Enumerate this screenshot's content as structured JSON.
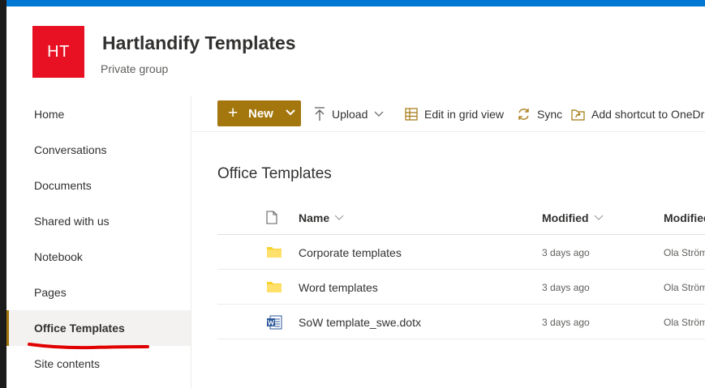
{
  "site": {
    "logo_initials": "HT",
    "title": "Hartlandify Templates",
    "subtitle": "Private group",
    "logo_color": "#e81123",
    "accent": "#a4770e",
    "suite_bar_color": "#0078d4"
  },
  "nav": {
    "items": [
      {
        "label": "Home"
      },
      {
        "label": "Conversations"
      },
      {
        "label": "Documents"
      },
      {
        "label": "Shared with us"
      },
      {
        "label": "Notebook"
      },
      {
        "label": "Pages"
      },
      {
        "label": "Office Templates",
        "selected": true
      },
      {
        "label": "Site contents"
      }
    ],
    "annotation_color": "#e00000"
  },
  "commands": {
    "new": "New",
    "upload": "Upload",
    "grid": "Edit in grid view",
    "sync": "Sync",
    "shortcut": "Add shortcut to OneDrive"
  },
  "library": {
    "title": "Office Templates",
    "columns": {
      "name": "Name",
      "modified": "Modified",
      "modified_by": "Modified By"
    },
    "rows": [
      {
        "icon": "folder-icon",
        "name": "Corporate templates",
        "modified": "3 days ago",
        "modified_by": "Ola Strömberg"
      },
      {
        "icon": "folder-icon",
        "name": "Word templates",
        "modified": "3 days ago",
        "modified_by": "Ola Strömberg"
      },
      {
        "icon": "word-file-icon",
        "name": "SoW template_swe.dotx",
        "modified": "3 days ago",
        "modified_by": "Ola Strömberg"
      }
    ]
  }
}
